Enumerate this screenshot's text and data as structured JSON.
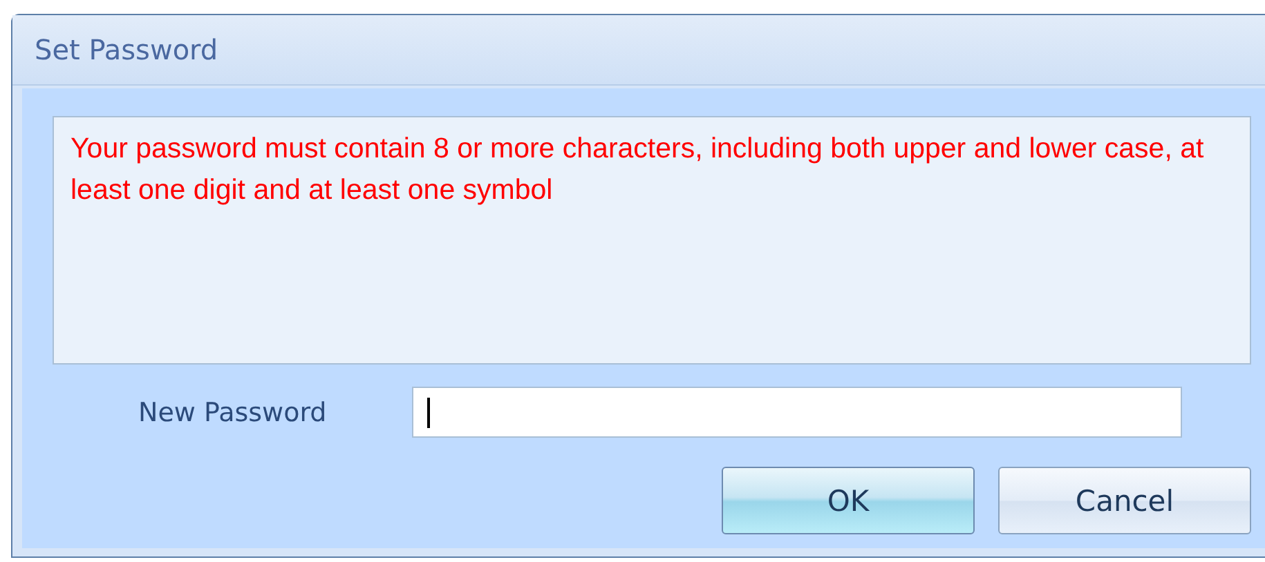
{
  "window": {
    "title": "Set Password"
  },
  "message": "Your password must contain 8 or more characters, including both upper and lower case, at least one digit and at least one symbol",
  "password_field": {
    "label": "New Password",
    "focused": true
  },
  "buttons": [
    {
      "label": "OK",
      "default": true
    },
    {
      "label": "Cancel",
      "default": false
    }
  ]
}
